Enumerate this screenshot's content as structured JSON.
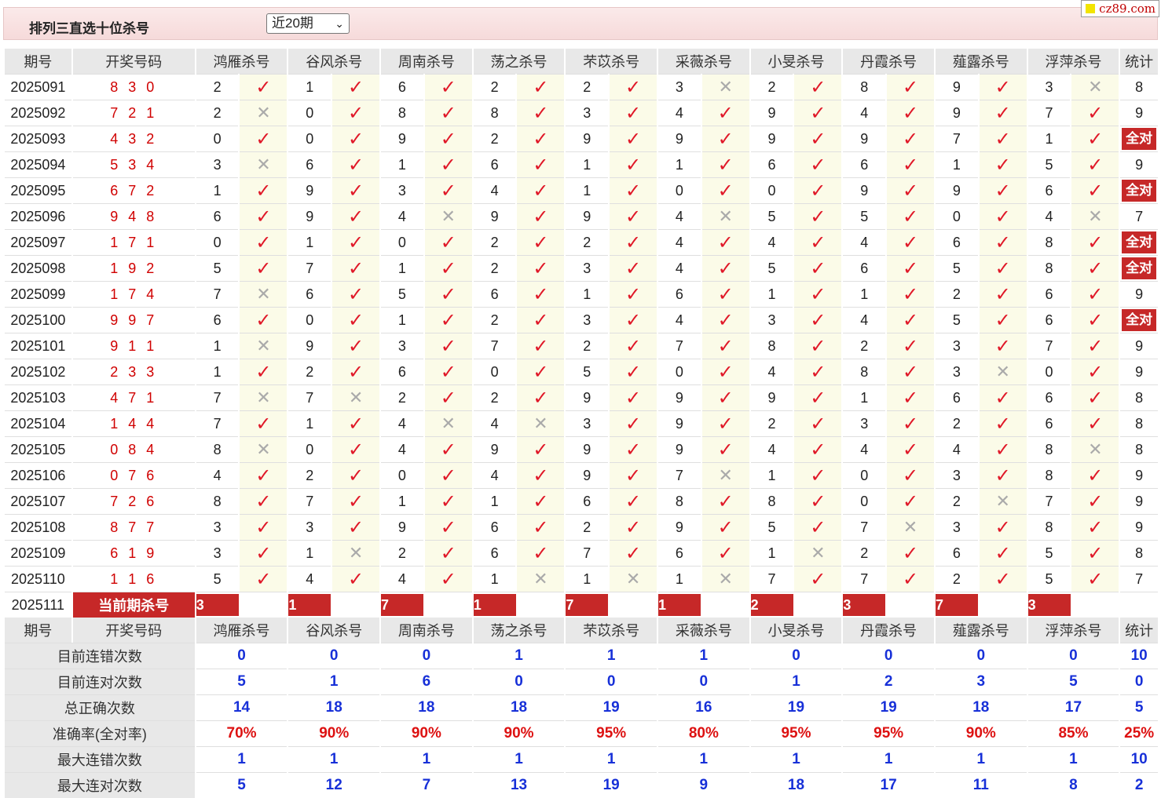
{
  "title": "排列三直选十位杀号",
  "period_select": {
    "value": "近20期",
    "options": [
      "近20期"
    ]
  },
  "logo": "cz89.com",
  "header": {
    "period": "期号",
    "draw": "开奖号码",
    "experts": [
      "鸿雁杀号",
      "谷风杀号",
      "周南杀号",
      "荡之杀号",
      "芣苡杀号",
      "采薇杀号",
      "小旻杀号",
      "丹霞杀号",
      "薤露杀号",
      "浮萍杀号"
    ],
    "stat": "统计"
  },
  "all_right_label": "全对",
  "rows": [
    {
      "p": "2025091",
      "d": "8 3 0",
      "k": [
        [
          "2",
          "ok"
        ],
        [
          "1",
          "ok"
        ],
        [
          "6",
          "ok"
        ],
        [
          "2",
          "ok"
        ],
        [
          "2",
          "ok"
        ],
        [
          "3",
          "no"
        ],
        [
          "2",
          "ok"
        ],
        [
          "8",
          "ok"
        ],
        [
          "9",
          "ok"
        ],
        [
          "3",
          "no"
        ]
      ],
      "s": "8"
    },
    {
      "p": "2025092",
      "d": "7 2 1",
      "k": [
        [
          "2",
          "no"
        ],
        [
          "0",
          "ok"
        ],
        [
          "8",
          "ok"
        ],
        [
          "8",
          "ok"
        ],
        [
          "3",
          "ok"
        ],
        [
          "4",
          "ok"
        ],
        [
          "9",
          "ok"
        ],
        [
          "4",
          "ok"
        ],
        [
          "9",
          "ok"
        ],
        [
          "7",
          "ok"
        ]
      ],
      "s": "9"
    },
    {
      "p": "2025093",
      "d": "4 3 2",
      "k": [
        [
          "0",
          "ok"
        ],
        [
          "0",
          "ok"
        ],
        [
          "9",
          "ok"
        ],
        [
          "2",
          "ok"
        ],
        [
          "9",
          "ok"
        ],
        [
          "9",
          "ok"
        ],
        [
          "9",
          "ok"
        ],
        [
          "9",
          "ok"
        ],
        [
          "7",
          "ok"
        ],
        [
          "1",
          "ok"
        ]
      ],
      "s": "全对"
    },
    {
      "p": "2025094",
      "d": "5 3 4",
      "k": [
        [
          "3",
          "no"
        ],
        [
          "6",
          "ok"
        ],
        [
          "1",
          "ok"
        ],
        [
          "6",
          "ok"
        ],
        [
          "1",
          "ok"
        ],
        [
          "1",
          "ok"
        ],
        [
          "6",
          "ok"
        ],
        [
          "6",
          "ok"
        ],
        [
          "1",
          "ok"
        ],
        [
          "5",
          "ok"
        ]
      ],
      "s": "9"
    },
    {
      "p": "2025095",
      "d": "6 7 2",
      "k": [
        [
          "1",
          "ok"
        ],
        [
          "9",
          "ok"
        ],
        [
          "3",
          "ok"
        ],
        [
          "4",
          "ok"
        ],
        [
          "1",
          "ok"
        ],
        [
          "0",
          "ok"
        ],
        [
          "0",
          "ok"
        ],
        [
          "9",
          "ok"
        ],
        [
          "9",
          "ok"
        ],
        [
          "6",
          "ok"
        ]
      ],
      "s": "全对"
    },
    {
      "p": "2025096",
      "d": "9 4 8",
      "k": [
        [
          "6",
          "ok"
        ],
        [
          "9",
          "ok"
        ],
        [
          "4",
          "no"
        ],
        [
          "9",
          "ok"
        ],
        [
          "9",
          "ok"
        ],
        [
          "4",
          "no"
        ],
        [
          "5",
          "ok"
        ],
        [
          "5",
          "ok"
        ],
        [
          "0",
          "ok"
        ],
        [
          "4",
          "no"
        ]
      ],
      "s": "7"
    },
    {
      "p": "2025097",
      "d": "1 7 1",
      "k": [
        [
          "0",
          "ok"
        ],
        [
          "1",
          "ok"
        ],
        [
          "0",
          "ok"
        ],
        [
          "2",
          "ok"
        ],
        [
          "2",
          "ok"
        ],
        [
          "4",
          "ok"
        ],
        [
          "4",
          "ok"
        ],
        [
          "4",
          "ok"
        ],
        [
          "6",
          "ok"
        ],
        [
          "8",
          "ok"
        ]
      ],
      "s": "全对"
    },
    {
      "p": "2025098",
      "d": "1 9 2",
      "k": [
        [
          "5",
          "ok"
        ],
        [
          "7",
          "ok"
        ],
        [
          "1",
          "ok"
        ],
        [
          "2",
          "ok"
        ],
        [
          "3",
          "ok"
        ],
        [
          "4",
          "ok"
        ],
        [
          "5",
          "ok"
        ],
        [
          "6",
          "ok"
        ],
        [
          "5",
          "ok"
        ],
        [
          "8",
          "ok"
        ]
      ],
      "s": "全对"
    },
    {
      "p": "2025099",
      "d": "1 7 4",
      "k": [
        [
          "7",
          "no"
        ],
        [
          "6",
          "ok"
        ],
        [
          "5",
          "ok"
        ],
        [
          "6",
          "ok"
        ],
        [
          "1",
          "ok"
        ],
        [
          "6",
          "ok"
        ],
        [
          "1",
          "ok"
        ],
        [
          "1",
          "ok"
        ],
        [
          "2",
          "ok"
        ],
        [
          "6",
          "ok"
        ]
      ],
      "s": "9"
    },
    {
      "p": "2025100",
      "d": "9 9 7",
      "k": [
        [
          "6",
          "ok"
        ],
        [
          "0",
          "ok"
        ],
        [
          "1",
          "ok"
        ],
        [
          "2",
          "ok"
        ],
        [
          "3",
          "ok"
        ],
        [
          "4",
          "ok"
        ],
        [
          "3",
          "ok"
        ],
        [
          "4",
          "ok"
        ],
        [
          "5",
          "ok"
        ],
        [
          "6",
          "ok"
        ]
      ],
      "s": "全对"
    },
    {
      "p": "2025101",
      "d": "9 1 1",
      "k": [
        [
          "1",
          "no"
        ],
        [
          "9",
          "ok"
        ],
        [
          "3",
          "ok"
        ],
        [
          "7",
          "ok"
        ],
        [
          "2",
          "ok"
        ],
        [
          "7",
          "ok"
        ],
        [
          "8",
          "ok"
        ],
        [
          "2",
          "ok"
        ],
        [
          "3",
          "ok"
        ],
        [
          "7",
          "ok"
        ]
      ],
      "s": "9"
    },
    {
      "p": "2025102",
      "d": "2 3 3",
      "k": [
        [
          "1",
          "ok"
        ],
        [
          "2",
          "ok"
        ],
        [
          "6",
          "ok"
        ],
        [
          "0",
          "ok"
        ],
        [
          "5",
          "ok"
        ],
        [
          "0",
          "ok"
        ],
        [
          "4",
          "ok"
        ],
        [
          "8",
          "ok"
        ],
        [
          "3",
          "no"
        ],
        [
          "0",
          "ok"
        ]
      ],
      "s": "9"
    },
    {
      "p": "2025103",
      "d": "4 7 1",
      "k": [
        [
          "7",
          "no"
        ],
        [
          "7",
          "no"
        ],
        [
          "2",
          "ok"
        ],
        [
          "2",
          "ok"
        ],
        [
          "9",
          "ok"
        ],
        [
          "9",
          "ok"
        ],
        [
          "9",
          "ok"
        ],
        [
          "1",
          "ok"
        ],
        [
          "6",
          "ok"
        ],
        [
          "6",
          "ok"
        ]
      ],
      "s": "8"
    },
    {
      "p": "2025104",
      "d": "1 4 4",
      "k": [
        [
          "7",
          "ok"
        ],
        [
          "1",
          "ok"
        ],
        [
          "4",
          "no"
        ],
        [
          "4",
          "no"
        ],
        [
          "3",
          "ok"
        ],
        [
          "9",
          "ok"
        ],
        [
          "2",
          "ok"
        ],
        [
          "3",
          "ok"
        ],
        [
          "2",
          "ok"
        ],
        [
          "6",
          "ok"
        ]
      ],
      "s": "8"
    },
    {
      "p": "2025105",
      "d": "0 8 4",
      "k": [
        [
          "8",
          "no"
        ],
        [
          "0",
          "ok"
        ],
        [
          "4",
          "ok"
        ],
        [
          "9",
          "ok"
        ],
        [
          "9",
          "ok"
        ],
        [
          "9",
          "ok"
        ],
        [
          "4",
          "ok"
        ],
        [
          "4",
          "ok"
        ],
        [
          "4",
          "ok"
        ],
        [
          "8",
          "no"
        ]
      ],
      "s": "8"
    },
    {
      "p": "2025106",
      "d": "0 7 6",
      "k": [
        [
          "4",
          "ok"
        ],
        [
          "2",
          "ok"
        ],
        [
          "0",
          "ok"
        ],
        [
          "4",
          "ok"
        ],
        [
          "9",
          "ok"
        ],
        [
          "7",
          "no"
        ],
        [
          "1",
          "ok"
        ],
        [
          "0",
          "ok"
        ],
        [
          "3",
          "ok"
        ],
        [
          "8",
          "ok"
        ]
      ],
      "s": "9"
    },
    {
      "p": "2025107",
      "d": "7 2 6",
      "k": [
        [
          "8",
          "ok"
        ],
        [
          "7",
          "ok"
        ],
        [
          "1",
          "ok"
        ],
        [
          "1",
          "ok"
        ],
        [
          "6",
          "ok"
        ],
        [
          "8",
          "ok"
        ],
        [
          "8",
          "ok"
        ],
        [
          "0",
          "ok"
        ],
        [
          "2",
          "no"
        ],
        [
          "7",
          "ok"
        ]
      ],
      "s": "9"
    },
    {
      "p": "2025108",
      "d": "8 7 7",
      "k": [
        [
          "3",
          "ok"
        ],
        [
          "3",
          "ok"
        ],
        [
          "9",
          "ok"
        ],
        [
          "6",
          "ok"
        ],
        [
          "2",
          "ok"
        ],
        [
          "9",
          "ok"
        ],
        [
          "5",
          "ok"
        ],
        [
          "7",
          "no"
        ],
        [
          "3",
          "ok"
        ],
        [
          "8",
          "ok"
        ]
      ],
      "s": "9"
    },
    {
      "p": "2025109",
      "d": "6 1 9",
      "k": [
        [
          "3",
          "ok"
        ],
        [
          "1",
          "no"
        ],
        [
          "2",
          "ok"
        ],
        [
          "6",
          "ok"
        ],
        [
          "7",
          "ok"
        ],
        [
          "6",
          "ok"
        ],
        [
          "1",
          "no"
        ],
        [
          "2",
          "ok"
        ],
        [
          "6",
          "ok"
        ],
        [
          "5",
          "ok"
        ]
      ],
      "s": "8"
    },
    {
      "p": "2025110",
      "d": "1 1 6",
      "k": [
        [
          "5",
          "ok"
        ],
        [
          "4",
          "ok"
        ],
        [
          "4",
          "ok"
        ],
        [
          "1",
          "no"
        ],
        [
          "1",
          "no"
        ],
        [
          "1",
          "no"
        ],
        [
          "7",
          "ok"
        ],
        [
          "7",
          "ok"
        ],
        [
          "2",
          "ok"
        ],
        [
          "5",
          "ok"
        ]
      ],
      "s": "7"
    }
  ],
  "current": {
    "period": "2025111",
    "label": "当前期杀号",
    "kills": [
      "3",
      "1",
      "7",
      "1",
      "7",
      "1",
      "2",
      "3",
      "7",
      "3"
    ]
  },
  "stats": [
    {
      "label": "目前连错次数",
      "vals": [
        "0",
        "0",
        "0",
        "1",
        "1",
        "1",
        "0",
        "0",
        "0",
        "0"
      ],
      "s": "10",
      "red": false
    },
    {
      "label": "目前连对次数",
      "vals": [
        "5",
        "1",
        "6",
        "0",
        "0",
        "0",
        "1",
        "2",
        "3",
        "5"
      ],
      "s": "0",
      "red": false
    },
    {
      "label": "总正确次数",
      "vals": [
        "14",
        "18",
        "18",
        "18",
        "19",
        "16",
        "19",
        "19",
        "18",
        "17"
      ],
      "s": "5",
      "red": false
    },
    {
      "label": "准确率(全对率)",
      "vals": [
        "70%",
        "90%",
        "90%",
        "90%",
        "95%",
        "80%",
        "95%",
        "95%",
        "90%",
        "85%"
      ],
      "s": "25%",
      "red": true
    },
    {
      "label": "最大连错次数",
      "vals": [
        "1",
        "1",
        "1",
        "1",
        "1",
        "1",
        "1",
        "1",
        "1",
        "1"
      ],
      "s": "10",
      "red": false
    },
    {
      "label": "最大连对次数",
      "vals": [
        "5",
        "12",
        "7",
        "13",
        "19",
        "9",
        "18",
        "17",
        "11",
        "8"
      ],
      "s": "2",
      "red": false
    }
  ],
  "marks": {
    "ok": "✓",
    "no": "✕"
  },
  "colors": {
    "accent_red": "#c62828",
    "blue": "#1730d8",
    "header_bg": "#e8e8e8",
    "mark_bg": "#fbfbe8"
  }
}
